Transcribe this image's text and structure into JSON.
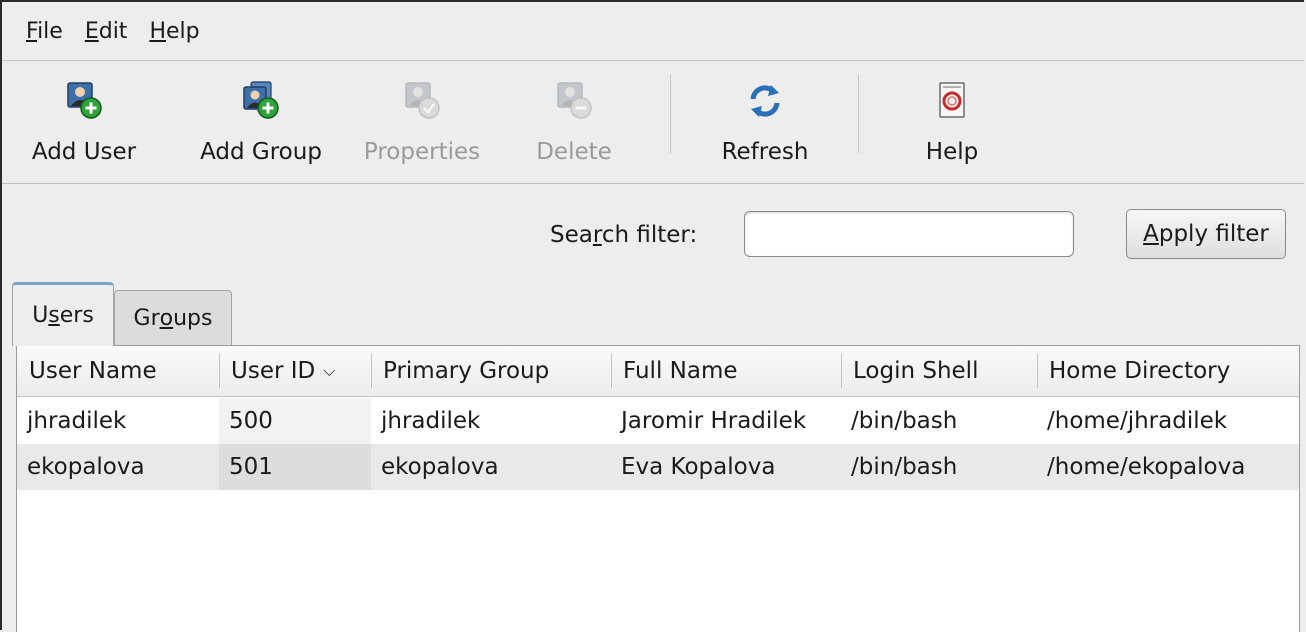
{
  "menu": {
    "file": {
      "mnemonic": "F",
      "rest": "ile"
    },
    "edit": {
      "mnemonic": "E",
      "rest": "dit"
    },
    "help": {
      "mnemonic": "H",
      "rest": "elp"
    }
  },
  "toolbar": {
    "add_user": "Add User",
    "add_group": "Add Group",
    "properties": "Properties",
    "delete": "Delete",
    "refresh": "Refresh",
    "help": "Help"
  },
  "filter": {
    "label_pre": "Sea",
    "label_mnemonic": "r",
    "label_post": "ch filter:",
    "value": "",
    "apply_mnemonic": "A",
    "apply_rest": "pply filter"
  },
  "tabs": {
    "users": {
      "pre": "U",
      "mnemonic": "s",
      "post": "ers"
    },
    "groups": {
      "pre": "Gr",
      "mnemonic": "o",
      "post": "ups"
    }
  },
  "table": {
    "columns": [
      "User Name",
      "User ID",
      "Primary Group",
      "Full Name",
      "Login Shell",
      "Home Directory"
    ],
    "sort_indicator": "chevron-down-icon",
    "rows": [
      [
        "jhradilek",
        "500",
        "jhradilek",
        "Jaromir Hradilek",
        "/bin/bash",
        "/home/jhradilek"
      ],
      [
        "ekopalova",
        "501",
        "ekopalova",
        "Eva Kopalova",
        "/bin/bash",
        "/home/ekopalova"
      ]
    ]
  },
  "colors": {
    "add_badge": "#2fa33a",
    "refresh_blue": "#2a6fb8",
    "tab_active_accent": "#7aa5cf"
  }
}
